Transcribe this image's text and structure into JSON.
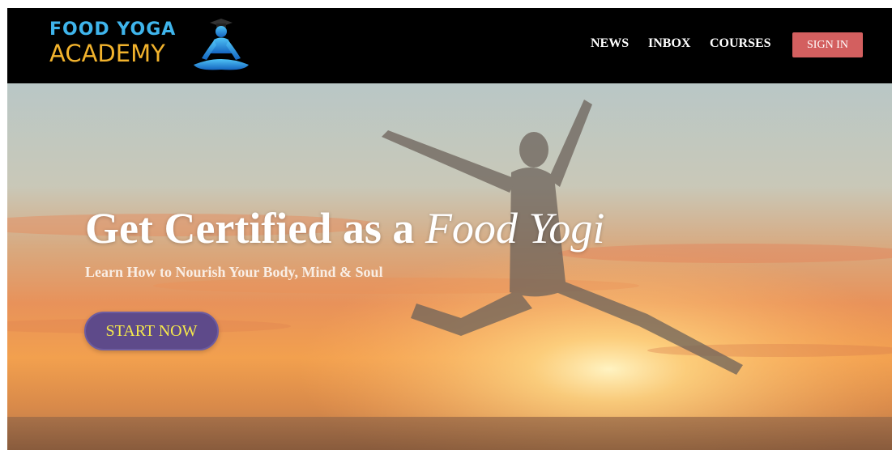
{
  "brand": {
    "line1": "FOOD YOGA",
    "line2": "ACADEMY",
    "color_line1": "#3fb5ec",
    "color_line2": "#f2b32d"
  },
  "nav": {
    "items": [
      {
        "label": "NEWS"
      },
      {
        "label": "INBOX"
      },
      {
        "label": "COURSES"
      }
    ],
    "signin_label": "SIGN IN",
    "signin_color": "#d35f5f"
  },
  "hero": {
    "title_main": "Get Certified as a ",
    "title_emphasis": "Food Yogi",
    "subtitle": "Learn How to Nourish Your Body, Mind & Soul",
    "cta_label": "START NOW",
    "cta_color": "#5e4a8a",
    "cta_text_color": "#f5e94b",
    "background": "sunset-sky-with-jumping-woman"
  }
}
